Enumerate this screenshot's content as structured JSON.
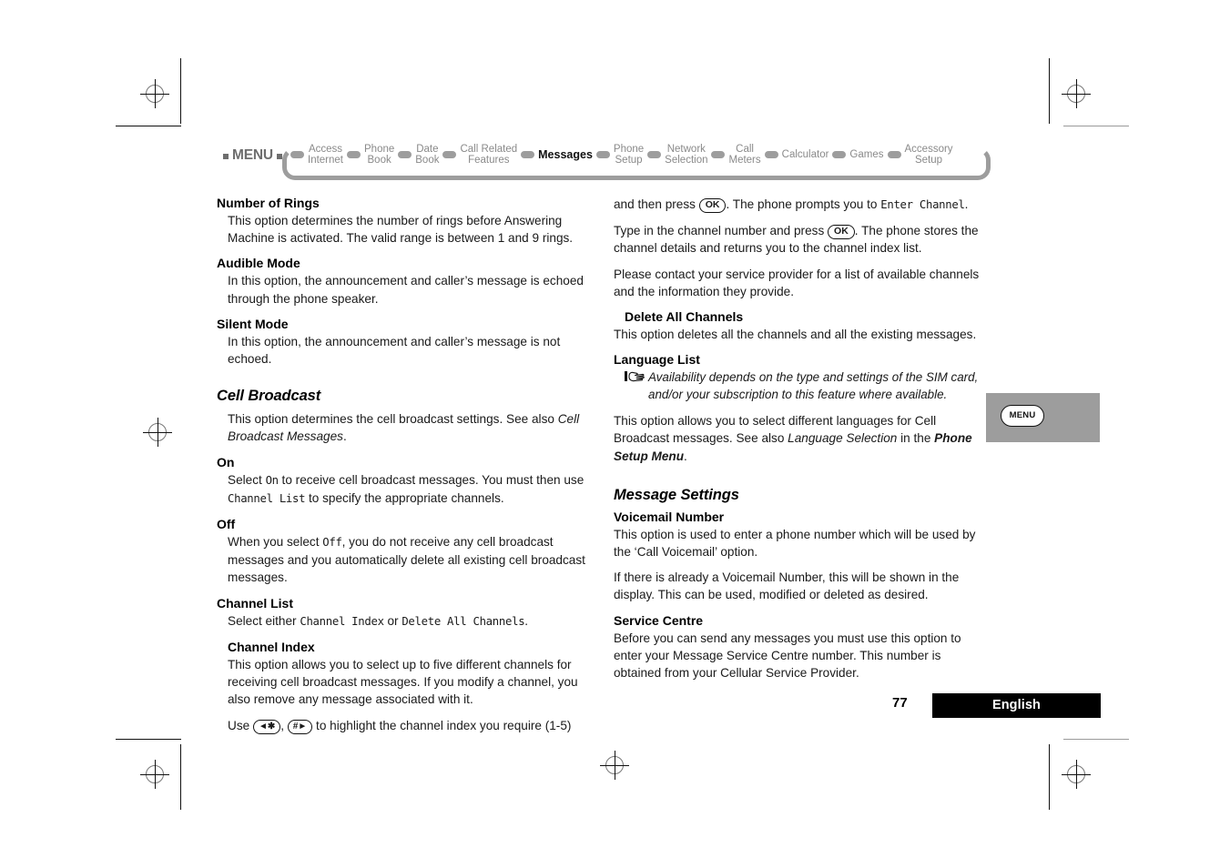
{
  "menu_map": {
    "menu_label": "MENU",
    "items": [
      {
        "label": "Access\nInternet",
        "current": false
      },
      {
        "label": "Phone\nBook",
        "current": false
      },
      {
        "label": "Date\nBook",
        "current": false
      },
      {
        "label": "Call Related\nFeatures",
        "current": false
      },
      {
        "label": "Messages",
        "current": true
      },
      {
        "label": "Phone\nSetup",
        "current": false
      },
      {
        "label": "Network\nSelection",
        "current": false
      },
      {
        "label": "Call\nMeters",
        "current": false
      },
      {
        "label": "Calculator",
        "current": false
      },
      {
        "label": "Games",
        "current": false
      },
      {
        "label": "Accessory\nSetup",
        "current": false
      }
    ]
  },
  "left_column": {
    "number_of_rings_heading": "Number of Rings",
    "number_of_rings_body": "This option determines the number of rings before Answering Machine is activated. The valid range is between 1 and 9 rings.",
    "audible_mode_heading": "Audible Mode",
    "audible_mode_body": "In this option, the announcement and caller’s message is echoed through the phone speaker.",
    "silent_mode_heading": "Silent Mode",
    "silent_mode_body": "In this option, the announcement and caller’s message is not echoed.",
    "cell_broadcast_heading": "Cell Broadcast",
    "cell_broadcast_body_1": "This option determines the cell broadcast settings. See also ",
    "cell_broadcast_body_italic": "Cell Broadcast Messages",
    "cell_broadcast_body_2": ".",
    "on_heading": "On",
    "on_body_1": "Select ",
    "on_body_mono_1": "On",
    "on_body_2": " to receive cell broadcast messages. You must then use ",
    "on_body_mono_2": "Channel List",
    "on_body_3": " to specify the appropriate channels.",
    "off_heading": "Off",
    "off_body_1": "When you select ",
    "off_body_mono_1": "Off",
    "off_body_2": ", you do not receive any cell broadcast messages and you automatically delete all existing cell broadcast messages.",
    "channel_list_heading": "Channel List",
    "channel_list_body_1": "Select either ",
    "channel_list_mono_1": "Channel Index",
    "channel_list_body_2": " or ",
    "channel_list_mono_2": "Delete All Channels",
    "channel_list_body_3": ".",
    "channel_index_heading": "Channel Index",
    "channel_index_body": "This option allows you to select up to five different channels for receiving cell broadcast messages. If you modify a channel, you also remove any message associated with it.",
    "use_keys_prefix": "Use ",
    "key_star": "◄✱",
    "use_keys_sep": ", ",
    "key_hash": "#►",
    "use_keys_suffix": " to highlight the channel index you require (1-5)"
  },
  "right_column": {
    "continuation_1": "and then press ",
    "key_ok_1": "OK",
    "continuation_2": ". The phone prompts you to ",
    "continuation_mono": "Enter Channel",
    "continuation_3": ".",
    "type_in_1": "Type in the channel number and press ",
    "key_ok_2": "OK",
    "type_in_2": ". The phone stores the channel details and returns you to the channel index list.",
    "contact_provider_body": "Please contact your service provider for a list of available channels and the information they provide.",
    "delete_all_channels_heading": "Delete All Channels",
    "delete_all_channels_body": "This option deletes all the channels and all the existing messages.",
    "language_list_heading": "Language List",
    "language_list_note": "Availability depends on the type and settings of the SIM card, and/or your subscription to this feature where available.",
    "language_list_body_1": "This option allows you to select different languages for Cell Broadcast messages. See also ",
    "language_list_body_italic": "Language Selection",
    "language_list_body_2": " in the ",
    "language_list_body_bold": "Phone Setup Menu",
    "language_list_body_3": ".",
    "message_settings_heading": "Message Settings",
    "voicemail_number_heading": "Voicemail Number",
    "voicemail_number_body_1": "This option is used to enter a phone number which will be used by the ‘Call Voicemail’ option.",
    "voicemail_number_body_2": "If there is already a Voicemail Number, this will be shown in the display. This can be used, modified or deleted as desired.",
    "service_centre_heading": "Service Centre",
    "service_centre_body": "Before you can send any messages you must use this option to enter your Message Service Centre number. This number is obtained from your Cellular Service Provider."
  },
  "thumb_tab": {
    "label": "MENU"
  },
  "footer": {
    "page_number": "77",
    "language": "English"
  },
  "colors": {
    "map_gray": "#9d9d9d",
    "map_text_gray": "#8a8a8a",
    "tab_gray": "#9d9d9d",
    "footer_bar": "#000000"
  }
}
